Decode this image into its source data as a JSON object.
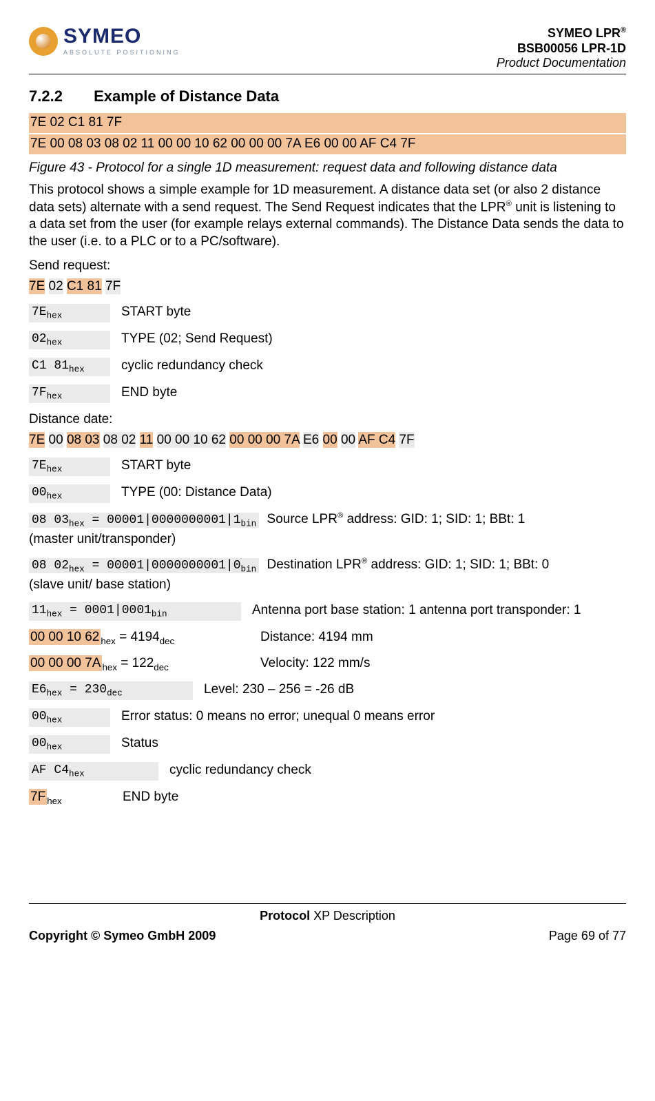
{
  "header": {
    "logo_main": "SYMEO",
    "logo_sub": "ABSOLUTE POSITIONING",
    "line1_a": "SYMEO LPR",
    "line1_sup": "®",
    "line2": "BSB00056 LPR-1D",
    "line3": "Product Documentation"
  },
  "section": {
    "number": "7.2.2",
    "title": "Example of Distance Data"
  },
  "packets": {
    "row1": "7E 02 C1 81 7F",
    "row2": "7E 00 08 03 08 02 11 00 00 10 62 00 00 00 7A E6 00 00 AF C4 7F"
  },
  "figcaption": "Figure 43 - Protocol for a single 1D measurement: request data and following distance data",
  "para1_a": "This protocol shows a simple example for 1D measurement. A distance data set (or also 2 distance data sets) alternate with a send request. The Send Request indicates that the LPR",
  "para1_sup": "®",
  "para1_b": " unit is listening to a data set from the user (for example relays external commands). The Distance Data sends the data to the user (i.e. to a PLC or to a PC/software).",
  "send_request_label": "Send request:",
  "sr_bytes": {
    "b0": "7E",
    "b1": "02",
    "b2": "C1 81",
    "b3": "7F"
  },
  "sr_rows": [
    {
      "code": "7E",
      "sub": "hex",
      "desc": "START byte"
    },
    {
      "code": "02",
      "sub": "hex",
      "desc": "TYPE (02; Send Request)"
    },
    {
      "code": "C1 81",
      "sub": "hex",
      "desc": "cyclic redundancy check"
    },
    {
      "code": "7F",
      "sub": "hex",
      "desc": "END byte"
    }
  ],
  "distance_label": "Distance date:",
  "dd_bytes": {
    "b0": "7E",
    "b1": "00",
    "b2": "08 03",
    "b3": "08 02",
    "b4": "11",
    "b5": "00 00 10 62",
    "b6": "00 00 00 7A",
    "b7": "E6",
    "b8": "00",
    "b9": "00",
    "b10": "AF C4",
    "b11": "7F"
  },
  "dd": {
    "r0": {
      "code": "7E",
      "sub": "hex",
      "desc": "START byte"
    },
    "r1": {
      "code": "00",
      "sub": "hex",
      "desc": "TYPE (00: Distance Data)"
    },
    "r2": {
      "code": "08 03",
      "sub": "hex",
      "eq": " = 00001|0000000001|1",
      "sub2": "bin",
      "desc_a": "Source LPR",
      "sup": "®",
      "desc_b": " address: GID: 1; SID: 1; BBt: 1",
      "note": "(master unit/transponder)"
    },
    "r3": {
      "code": "08 02",
      "sub": "hex",
      "eq": " = 00001|0000000001|0",
      "sub2": "bin",
      "desc_a": "Destination LPR",
      "sup": "®",
      "desc_b": " address: GID: 1; SID: 1; BBt: 0",
      "note": "(slave unit/ base station)"
    },
    "r4": {
      "code": "11",
      "sub": "hex",
      "eq": " = 0001|0001",
      "sub2": "bin",
      "desc": "Antenna port base station: 1 antenna port transponder: 1"
    },
    "r5": {
      "hl": "00 00 10 62",
      "sub": "hex",
      "eq": " = 4194",
      "sub2": "dec",
      "desc": "Distance: 4194 mm"
    },
    "r6": {
      "hl": "00 00 00 7A",
      "sub": "hex",
      "eq": " = 122",
      "sub2": "dec",
      "desc": "Velocity: 122 mm/s"
    },
    "r7": {
      "code": "E6",
      "sub": "hex",
      "eq": " = 230",
      "sub2": "dec",
      "desc": "Level: 230 – 256 = -26 dB"
    },
    "r8": {
      "code": "00",
      "sub": "hex",
      "desc": "Error status: 0 means no error; unequal 0 means error"
    },
    "r9": {
      "code": "00",
      "sub": "hex",
      "desc": "Status"
    },
    "r10": {
      "code": "AF C4",
      "sub": "hex",
      "desc": "cyclic redundancy check"
    },
    "r11": {
      "hl": "7F",
      "sub": "hex",
      "desc": "END byte"
    }
  },
  "footer": {
    "center_a": "Protocol",
    "center_b": " XP Description",
    "left": "Copyright © Symeo GmbH 2009",
    "right": "Page 69 of 77"
  }
}
